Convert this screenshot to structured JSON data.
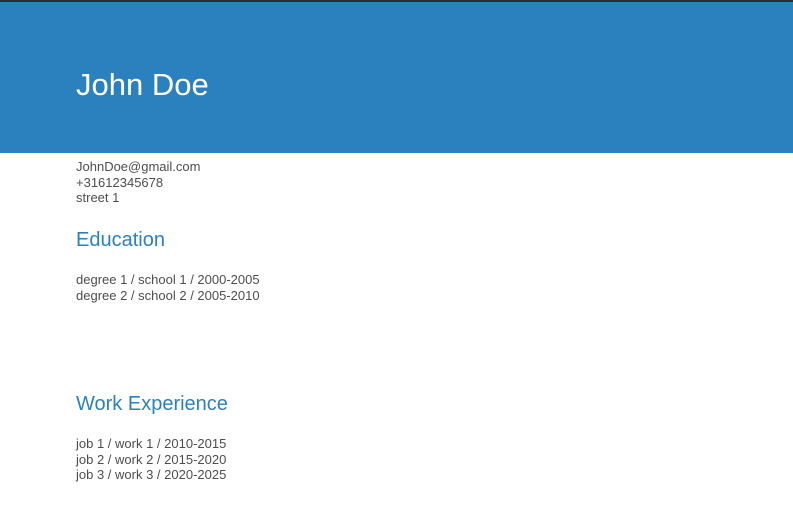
{
  "header": {
    "name": "John Doe"
  },
  "contact": {
    "email": "JohnDoe@gmail.com",
    "phone": "+31612345678",
    "address": "street 1"
  },
  "education": {
    "title": "Education",
    "entries": [
      "degree 1 / school 1 / 2000-2005",
      "degree 2 / school 2 / 2005-2010"
    ]
  },
  "work": {
    "title": "Work Experience",
    "entries": [
      "job 1 / work 1 / 2010-2015",
      "job 2 / work 2 / 2015-2020",
      "job 3 / work 3 / 2020-2025"
    ]
  },
  "colors": {
    "header_background": "#2a81bd",
    "accent": "#2a81bd",
    "body_text": "#4d4d4d"
  }
}
